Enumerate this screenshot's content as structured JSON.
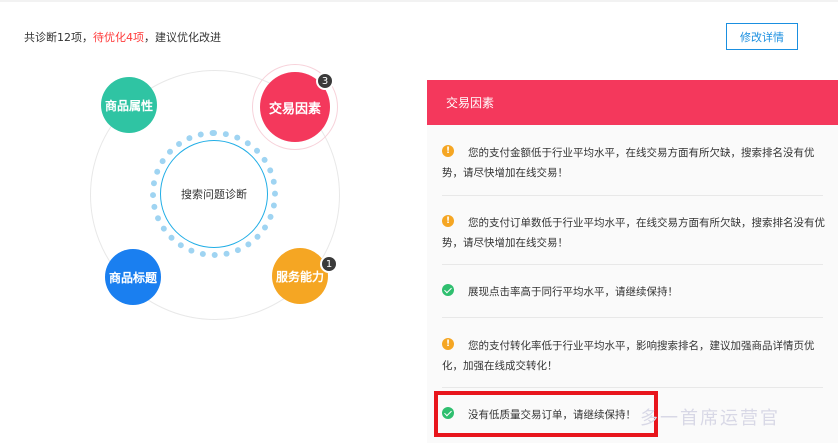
{
  "summary": {
    "prefix": "共诊断12项，",
    "pending": "待优化4项",
    "suffix": "，建议优化改进"
  },
  "detail_button": "修改详情",
  "diagram": {
    "center": "搜索问题诊断",
    "nodes": {
      "attr": "商品属性",
      "trade": "交易因素",
      "trade_badge": "3",
      "title": "商品标题",
      "service": "服务能力",
      "service_badge": "1"
    }
  },
  "panel": {
    "title": "交易因素",
    "issues": [
      {
        "status": "warning",
        "text": "您的支付金额低于行业平均水平，在线交易方面有所欠缺，搜索排名没有优势，请尽快增加在线交易！"
      },
      {
        "status": "warning",
        "text": "您的支付订单数低于行业平均水平，在线交易方面有所欠缺，搜索排名没有优势，请尽快增加在线交易！"
      },
      {
        "status": "ok",
        "text": "展现点击率高于同行平均水平，请继续保持！"
      },
      {
        "status": "warning",
        "text": "您的支付转化率低于行业平均水平，影响搜索排名，建议加强商品详情页优化，加强在线成交转化！"
      },
      {
        "status": "ok",
        "text": "没有低质量交易订单，请继续保持！"
      }
    ]
  },
  "watermark": "多一首席运营官",
  "colors": {
    "accent_red": "#f4385c",
    "link_blue": "#1a8fe0",
    "warning": "#f5a623",
    "ok": "#2fbf6f",
    "node_attr": "#2fc4a3",
    "node_title": "#1a7ff0",
    "node_service": "#f5a623"
  }
}
